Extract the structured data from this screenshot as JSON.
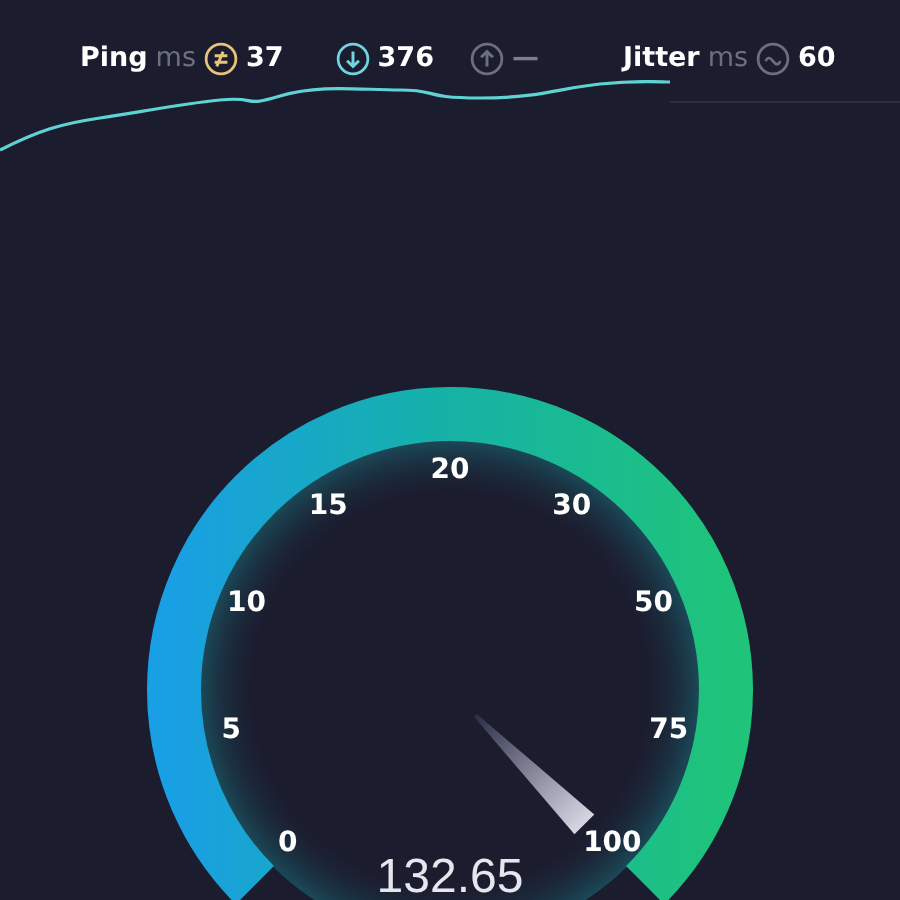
{
  "stats": [
    {
      "kind": "ping",
      "label": "Ping",
      "unit": "ms",
      "value": "37"
    },
    {
      "kind": "download",
      "value": "376"
    },
    {
      "kind": "upload",
      "value": "—"
    },
    {
      "kind": "jitter",
      "label": "Jitter",
      "unit": "ms",
      "value": "60"
    }
  ],
  "gauge": {
    "scale": [
      "0",
      "5",
      "10",
      "15",
      "20",
      "30",
      "50",
      "75",
      "100"
    ],
    "reading": "132.65"
  }
}
